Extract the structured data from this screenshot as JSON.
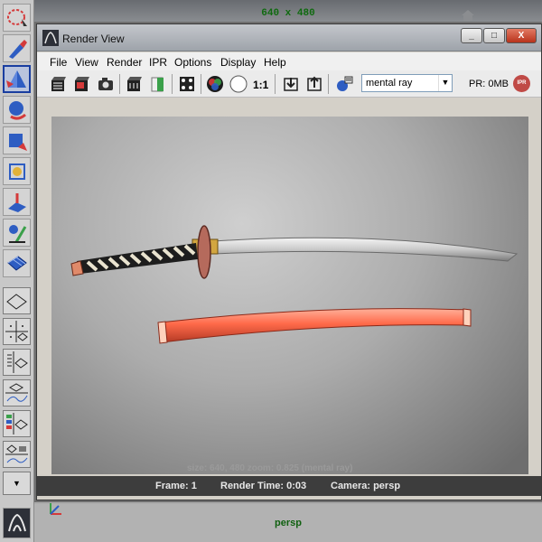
{
  "viewport": {
    "resolution_label": "640 x 480",
    "camera_label": "persp"
  },
  "tool_shelf": {
    "tools": [
      {
        "name": "lasso-select-icon"
      },
      {
        "name": "paint-select-icon"
      },
      {
        "name": "move-tool-icon"
      },
      {
        "name": "rotate-tool-icon"
      },
      {
        "name": "scale-tool-icon"
      },
      {
        "name": "universal-manipulator-icon"
      },
      {
        "name": "soft-modification-icon"
      },
      {
        "name": "show-manipulator-icon"
      },
      {
        "name": "last-tool-icon"
      }
    ],
    "layouts": [
      {
        "name": "single-perspective-layout-icon"
      },
      {
        "name": "four-view-layout-icon"
      },
      {
        "name": "outliner-perspective-layout-icon"
      },
      {
        "name": "graph-editor-layout-icon"
      },
      {
        "name": "hypershade-layout-icon"
      },
      {
        "name": "dope-sheet-layout-icon"
      }
    ],
    "dropdown_arrow": "▼"
  },
  "render_window": {
    "title": "Render View",
    "controls": {
      "minimize": "_",
      "maximize": "□",
      "close": "X"
    },
    "menu": [
      "File",
      "View",
      "Render",
      "IPR",
      "Options",
      "Display",
      "Help"
    ],
    "toolbar": {
      "ratio_label": "1:1",
      "renderer": "mental ray",
      "pr_label": "PR: 0MB",
      "ipr_badge": "IPR"
    },
    "render_info": "size: 640, 480 zoom: 0.825        (mental ray)",
    "status": {
      "frame": "Frame: 1",
      "render_time": "Render Time: 0:03",
      "camera": "Camera: persp"
    }
  },
  "colors": {
    "accent": "#1a3ea0",
    "viewport_label": "#0f6a0f",
    "scabbard": "#ff7a5e",
    "blade": "#c8c8c8"
  }
}
